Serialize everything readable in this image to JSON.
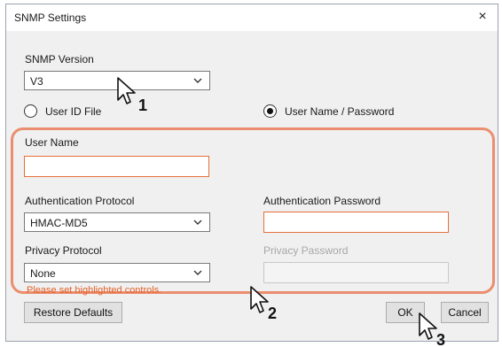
{
  "window": {
    "title": "SNMP Settings",
    "close_glyph": "×"
  },
  "snmp_version": {
    "label": "SNMP Version",
    "value": "V3"
  },
  "radios": {
    "user_id_file": "User ID File",
    "user_name_password": "User Name / Password",
    "selected": "user_name_password"
  },
  "user_name": {
    "label": "User Name",
    "value": ""
  },
  "auth_protocol": {
    "label": "Authentication Protocol",
    "value": "HMAC-MD5"
  },
  "auth_password": {
    "label": "Authentication Password",
    "value": ""
  },
  "privacy_protocol": {
    "label": "Privacy Protocol",
    "value": "None"
  },
  "privacy_password": {
    "label": "Privacy Password",
    "value": "",
    "disabled": true
  },
  "error_message": "Please set highlighted controls.",
  "buttons": {
    "restore_defaults": "Restore Defaults",
    "ok": "OK",
    "cancel": "Cancel"
  },
  "callouts": [
    "1",
    "2",
    "3"
  ],
  "colors": {
    "highlight": "#eb8e6f",
    "error": "#e2612a",
    "field_error_border": "#e6703a"
  },
  "icons": [
    "close-icon",
    "chevron-down-icon",
    "mouse-pointer-icon"
  ]
}
